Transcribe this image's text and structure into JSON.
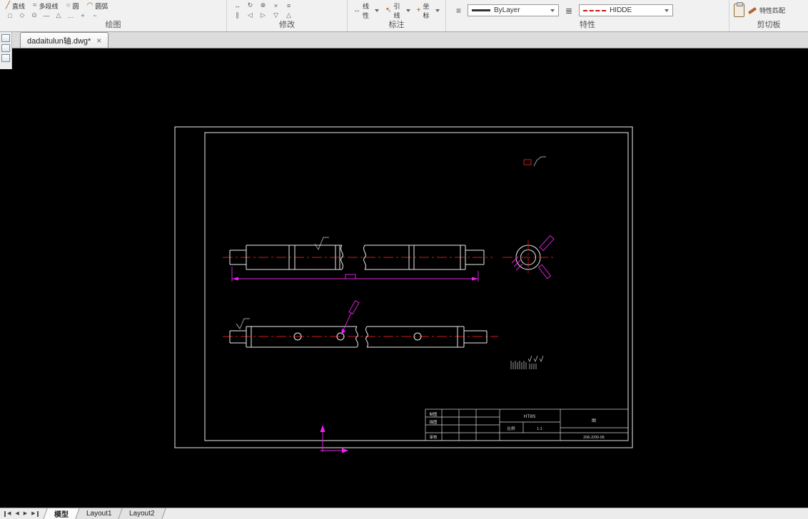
{
  "ribbon": {
    "panels": {
      "draw": {
        "label": "绘图",
        "tools": [
          {
            "label": "直线",
            "glyph": "╱"
          },
          {
            "label": "多段线",
            "glyph": "≈"
          },
          {
            "label": "圆",
            "glyph": "○"
          },
          {
            "label": "圆弧",
            "glyph": "◠"
          }
        ],
        "grid": [
          "□",
          "◇",
          "⊙",
          "—",
          "△",
          "…",
          "+",
          "~"
        ]
      },
      "modify": {
        "label": "修改",
        "grid": [
          "↔",
          "↻",
          "⊕",
          "×",
          "≡",
          "∥",
          "◁",
          "▷",
          "▽",
          "△"
        ]
      },
      "annotate": {
        "label": "标注",
        "tools": [
          {
            "label": "线性",
            "glyph": "↔"
          },
          {
            "label": "引线",
            "glyph": "↖"
          },
          {
            "label": "坐标",
            "glyph": "+"
          }
        ]
      },
      "properties": {
        "label": "特性",
        "menu_glyph": "≡",
        "stack_glyph": "≣",
        "lineweight": "ByLayer",
        "linetype": "HIDDE"
      },
      "clipboard": {
        "label": "剪切板",
        "match": "特性匹配"
      }
    }
  },
  "doc_tab": {
    "title": "dadaitulun轴.dwg*",
    "close": "×"
  },
  "drawing": {
    "title_block": {
      "material": "HT8S",
      "rows": [
        "制图",
        "描图",
        "审核"
      ],
      "scale_label": "比例",
      "scale_value": "1:1",
      "name": "图",
      "drawing_no": "206-2/00-05"
    }
  },
  "layout_bar": {
    "nav": [
      "◀",
      "◀",
      "▶",
      "▶"
    ],
    "tabs": [
      {
        "label": "模型"
      },
      {
        "label": "Layout1"
      },
      {
        "label": "Layout2"
      }
    ]
  }
}
